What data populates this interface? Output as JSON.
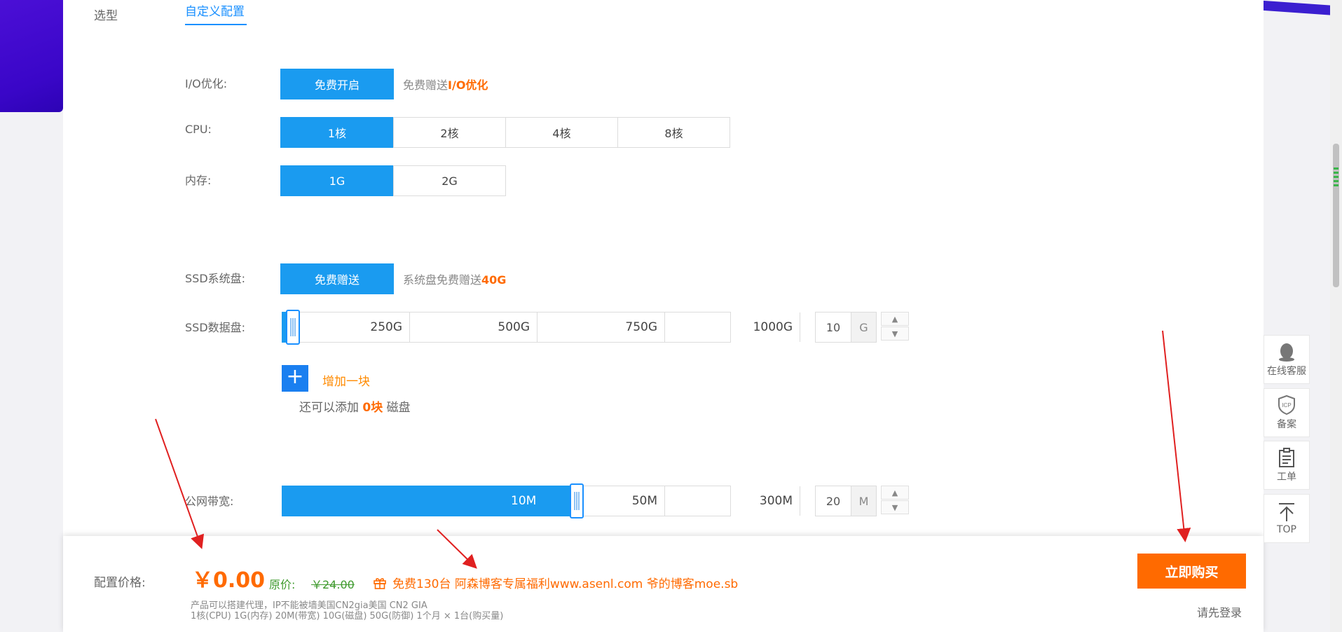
{
  "tabs": {
    "select": "选型",
    "custom": "自定义配置"
  },
  "io": {
    "label": "I/O优化:",
    "button": "免费开启",
    "desc_prefix": "免费赠送",
    "desc_highlight": "I/O优化"
  },
  "cpu": {
    "label": "CPU:",
    "options": [
      "1核",
      "2核",
      "4核",
      "8核"
    ],
    "selected": "1核"
  },
  "memory": {
    "label": "内存:",
    "options": [
      "1G",
      "2G"
    ],
    "selected": "1G"
  },
  "ssd_system": {
    "label": "SSD系统盘:",
    "button": "免费赠送",
    "desc_prefix": "系统盘免费赠送",
    "desc_highlight": "40G"
  },
  "ssd_data": {
    "label": "SSD数据盘:",
    "ticks": [
      "250G",
      "500G",
      "750G",
      "1000G"
    ],
    "value": "10",
    "unit": "G",
    "add_label": "增加一块",
    "remain_prefix": "还可以添加",
    "remain_count": "0块",
    "remain_suffix": "磁盘"
  },
  "bandwidth": {
    "label": "公网带宽:",
    "ticks": [
      "10M",
      "50M",
      "300M"
    ],
    "value": "20",
    "unit": "M"
  },
  "bottom": {
    "price_label": "配置价格:",
    "price": "￥0.00",
    "orig_label": "原价:",
    "orig_price": "￥24.00",
    "promo": "免费130台 阿森博客专属福利www.asenl.com 爷的博客moe.sb",
    "note1": "产品可以搭建代理，IP不能被墙美国CN2gia美国 CN2 GIA",
    "note2": "1核(CPU)  1G(内存)  20M(带宽)  10G(磁盘)  50G(防御)  1个月 × 1台(购买量)",
    "buy": "立即购买",
    "login": "请先登录"
  },
  "float_toolbar": [
    {
      "label": "在线客服",
      "icon": "qq-penguin-icon"
    },
    {
      "label": "备案",
      "icon": "icp-shield-icon"
    },
    {
      "label": "工单",
      "icon": "clipboard-icon"
    },
    {
      "label": "TOP",
      "icon": "arrow-up-icon"
    }
  ],
  "colors": {
    "accent": "#1a9bf0",
    "orange": "#ff6a00",
    "arrow": "#e02020"
  }
}
